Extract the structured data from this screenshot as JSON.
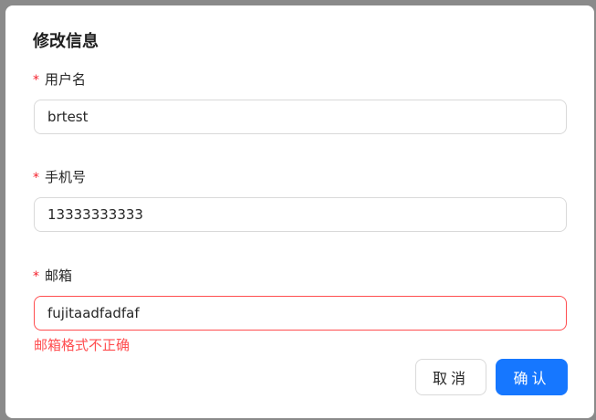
{
  "dialog": {
    "title": "修改信息",
    "required_mark": "*",
    "fields": [
      {
        "label": "用户名",
        "value": "brtest"
      },
      {
        "label": "手机号",
        "value": "13333333333"
      },
      {
        "label": "邮箱",
        "value": "fujitaadfadfaf",
        "error": "邮箱格式不正确"
      }
    ],
    "buttons": {
      "cancel": "取消",
      "ok": "确认"
    }
  },
  "colors": {
    "primary": "#1677ff",
    "error": "#ff4d4f",
    "required": "#f5222d"
  }
}
